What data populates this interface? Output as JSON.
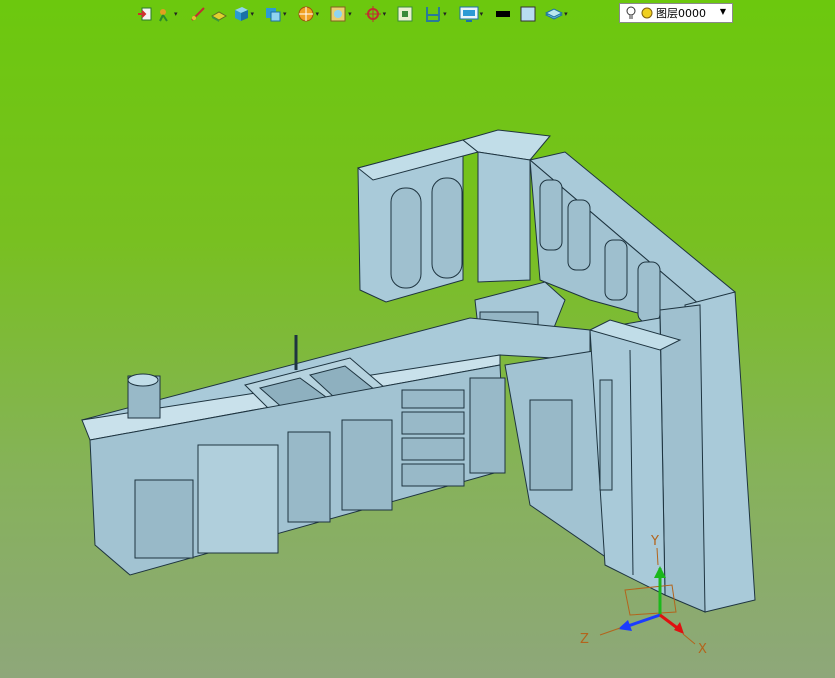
{
  "toolbar": {
    "icons": [
      "exit-sketch-icon",
      "constraint-icon",
      "line-tool-icon",
      "extrude-icon",
      "solid-box-icon",
      "feature-icon",
      "render-style-icon",
      "view-orient-icon",
      "snap-point-icon",
      "fit-view-icon",
      "section-icon",
      "display-icon",
      "color-black-icon",
      "color-blue-icon",
      "layer-shape-icon"
    ],
    "colors": {
      "black_swatch": "#000000",
      "blue_swatch": "#b8dcf0"
    }
  },
  "layer": {
    "label": "图层0000"
  },
  "viewport": {
    "background_top": "#6cc80e",
    "background_bottom": "#8ea77a",
    "model_color": "#a6c7d6",
    "triad": {
      "x_label": "X",
      "y_label": "Y",
      "z_label": "Z"
    }
  }
}
